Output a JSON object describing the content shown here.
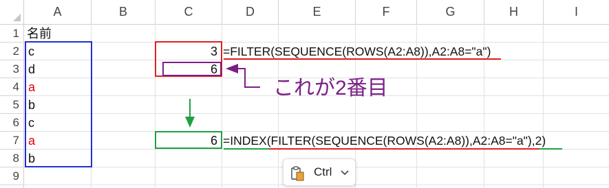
{
  "columns": [
    "A",
    "B",
    "C",
    "D",
    "E",
    "F",
    "G",
    "H",
    "I"
  ],
  "rows": [
    "1",
    "2",
    "3",
    "4",
    "5",
    "6",
    "7",
    "8",
    "9"
  ],
  "cells": {
    "a1": "名前",
    "a2": "c",
    "a3": "d",
    "a4": "a",
    "a5": "b",
    "a6": "c",
    "a7": "a",
    "a8": "b",
    "c2": "3",
    "c3": "6",
    "c7": "6",
    "d2": "=FILTER(SEQUENCE(ROWS(A2:A8)),A2:A8=\"a\")",
    "d7": "=INDEX(FILTER(SEQUENCE(ROWS(A2:A8)),A2:A8=\"a\"),2)"
  },
  "annotation": {
    "text": "これが2番目"
  },
  "paste_popup": {
    "label": "Ctrl",
    "icon": "clipboard-icon",
    "chevron": "chevron-down-icon"
  },
  "colors": {
    "blue_box": "#1f2fd0",
    "red_box": "#e02020",
    "green_box": "#20a040",
    "purple": "#7b1f86",
    "red_text": "#e00000"
  }
}
